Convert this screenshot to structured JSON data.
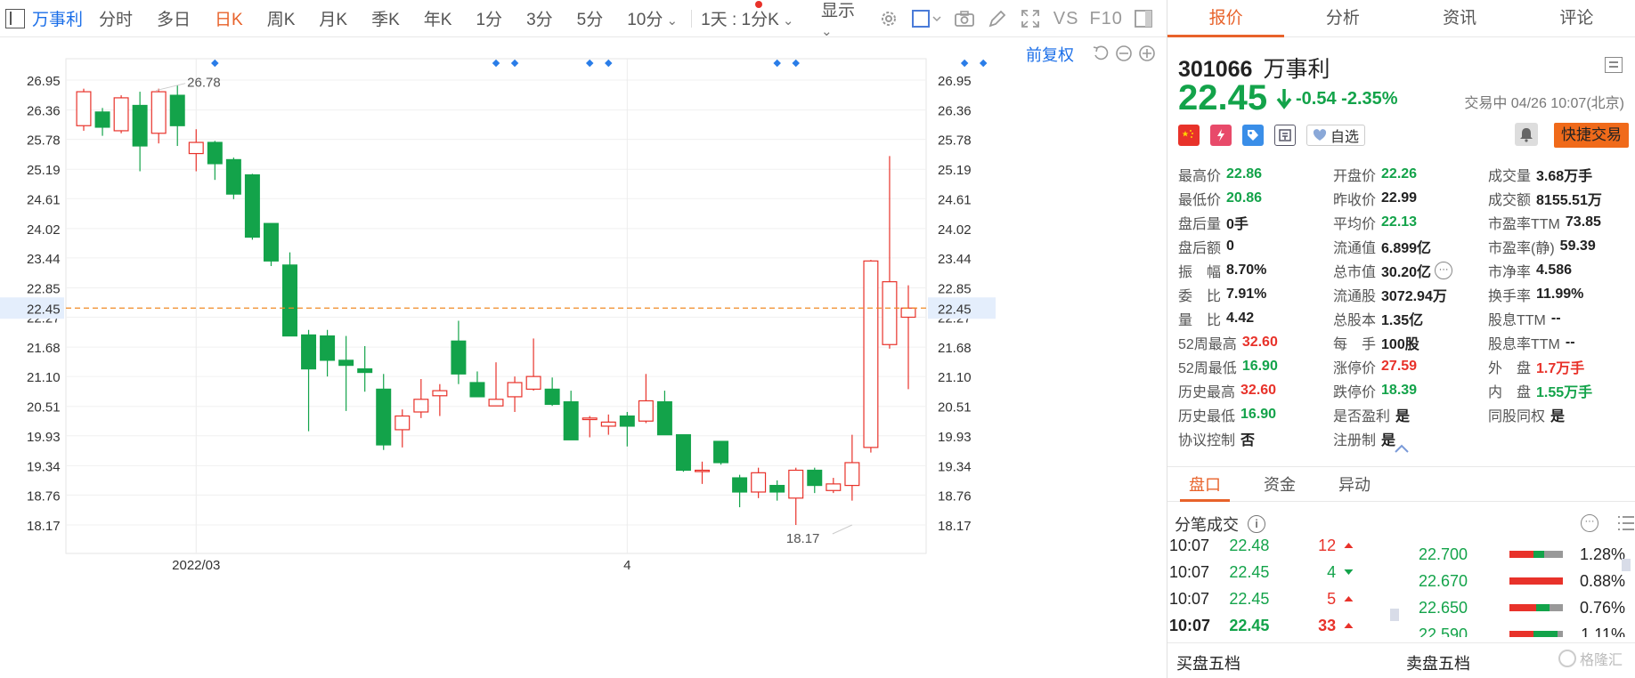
{
  "toolbar": {
    "stock_name": "万事利",
    "periods": [
      "分时",
      "多日",
      "日K",
      "周K",
      "月K",
      "季K",
      "年K",
      "1分",
      "3分",
      "5分",
      "10分"
    ],
    "active_period": "日K",
    "multi_period": "1天 : 1分K",
    "display": "显示",
    "vs": "VS",
    "f10": "F10"
  },
  "chart": {
    "adjust_label": "前复权",
    "current_price_label": "22.45",
    "high_annotation": "26.78",
    "low_annotation": "18.17"
  },
  "chart_data": {
    "type": "candlestick",
    "title": "",
    "x_tick_labels": [
      "2022/03",
      "4"
    ],
    "x_tick_index": [
      6,
      29
    ],
    "y_ticks": [
      "26.95",
      "26.36",
      "25.78",
      "25.19",
      "24.61",
      "24.02",
      "23.44",
      "22.85",
      "22.27",
      "21.68",
      "21.10",
      "20.51",
      "19.93",
      "19.34",
      "18.76",
      "18.17"
    ],
    "ylim": [
      18.17,
      26.95
    ],
    "grid": true,
    "current_price": 22.45,
    "high_annotation": {
      "index": 4,
      "value": 26.78
    },
    "low_annotation": {
      "index": 41,
      "value": 18.17
    },
    "marker_indices": [
      7,
      22,
      23,
      27,
      28,
      37,
      38,
      47,
      48
    ],
    "candles": [
      {
        "o": 26.05,
        "c": 26.72,
        "h": 26.78,
        "l": 25.95
      },
      {
        "o": 26.32,
        "c": 26.02,
        "h": 26.4,
        "l": 25.85
      },
      {
        "o": 25.95,
        "c": 26.6,
        "h": 26.65,
        "l": 25.9
      },
      {
        "o": 26.45,
        "c": 25.65,
        "h": 26.72,
        "l": 25.15
      },
      {
        "o": 25.9,
        "c": 26.72,
        "h": 26.78,
        "l": 25.7
      },
      {
        "o": 26.65,
        "c": 26.05,
        "h": 26.85,
        "l": 25.65
      },
      {
        "o": 25.5,
        "c": 25.72,
        "h": 25.98,
        "l": 25.15
      },
      {
        "o": 25.72,
        "c": 25.3,
        "h": 25.75,
        "l": 24.98
      },
      {
        "o": 25.38,
        "c": 24.7,
        "h": 25.42,
        "l": 24.6
      },
      {
        "o": 25.08,
        "c": 23.85,
        "h": 25.1,
        "l": 23.8
      },
      {
        "o": 24.12,
        "c": 23.38,
        "h": 24.12,
        "l": 23.28
      },
      {
        "o": 23.3,
        "c": 21.9,
        "h": 23.55,
        "l": 21.9
      },
      {
        "o": 21.92,
        "c": 21.25,
        "h": 22.02,
        "l": 20.02
      },
      {
        "o": 21.9,
        "c": 21.42,
        "h": 22.02,
        "l": 21.1
      },
      {
        "o": 21.42,
        "c": 21.32,
        "h": 21.9,
        "l": 20.42
      },
      {
        "o": 21.25,
        "c": 21.18,
        "h": 21.7,
        "l": 20.8
      },
      {
        "o": 20.85,
        "c": 19.75,
        "h": 21.15,
        "l": 19.65
      },
      {
        "o": 20.05,
        "c": 20.32,
        "h": 20.45,
        "l": 19.7
      },
      {
        "o": 20.4,
        "c": 20.65,
        "h": 21.05,
        "l": 20.28
      },
      {
        "o": 20.72,
        "c": 20.82,
        "h": 20.95,
        "l": 20.32
      },
      {
        "o": 21.8,
        "c": 21.15,
        "h": 22.2,
        "l": 20.95
      },
      {
        "o": 20.98,
        "c": 20.7,
        "h": 21.2,
        "l": 20.7
      },
      {
        "o": 20.52,
        "c": 20.65,
        "h": 21.38,
        "l": 20.52
      },
      {
        "o": 20.7,
        "c": 20.98,
        "h": 21.1,
        "l": 20.4
      },
      {
        "o": 20.85,
        "c": 21.1,
        "h": 21.85,
        "l": 20.82
      },
      {
        "o": 20.85,
        "c": 20.55,
        "h": 21.08,
        "l": 20.52
      },
      {
        "o": 20.6,
        "c": 19.85,
        "h": 20.82,
        "l": 19.85
      },
      {
        "o": 20.25,
        "c": 20.28,
        "h": 20.32,
        "l": 19.9
      },
      {
        "o": 20.12,
        "c": 20.2,
        "h": 20.35,
        "l": 19.95
      },
      {
        "o": 20.32,
        "c": 20.12,
        "h": 20.4,
        "l": 19.72
      },
      {
        "o": 20.22,
        "c": 20.62,
        "h": 21.15,
        "l": 20.18
      },
      {
        "o": 20.6,
        "c": 19.95,
        "h": 20.82,
        "l": 19.95
      },
      {
        "o": 19.95,
        "c": 19.25,
        "h": 19.95,
        "l": 19.22
      },
      {
        "o": 19.25,
        "c": 19.25,
        "h": 19.42,
        "l": 18.98
      },
      {
        "o": 19.82,
        "c": 19.4,
        "h": 19.82,
        "l": 19.36
      },
      {
        "o": 19.1,
        "c": 18.82,
        "h": 19.16,
        "l": 18.52
      },
      {
        "o": 18.82,
        "c": 19.2,
        "h": 19.3,
        "l": 18.7
      },
      {
        "o": 18.95,
        "c": 18.82,
        "h": 19.05,
        "l": 18.65
      },
      {
        "o": 18.7,
        "c": 19.25,
        "h": 19.3,
        "l": 18.17
      },
      {
        "o": 19.25,
        "c": 18.95,
        "h": 19.3,
        "l": 18.8
      },
      {
        "o": 18.85,
        "c": 18.98,
        "h": 19.1,
        "l": 18.8
      },
      {
        "o": 18.95,
        "c": 19.4,
        "h": 19.95,
        "l": 18.65
      },
      {
        "o": 19.7,
        "c": 23.38,
        "h": 23.4,
        "l": 19.6
      },
      {
        "o": 21.73,
        "c": 22.97,
        "h": 25.45,
        "l": 21.65
      },
      {
        "o": 22.27,
        "c": 22.45,
        "h": 22.9,
        "l": 20.85
      }
    ]
  },
  "quote": {
    "tabs": [
      "报价",
      "分析",
      "资讯",
      "评论"
    ],
    "active_tab": "报价",
    "code": "301066",
    "name": "万事利",
    "price": "22.45",
    "change": "-0.54",
    "change_pct": "-2.35%",
    "status_time": "交易中 04/26 10:07(北京)",
    "watch_label": "自选",
    "quick_trade": "快捷交易",
    "fields": [
      [
        {
          "k": "最高价",
          "v": "22.86",
          "c": "dn"
        },
        {
          "k": "开盘价",
          "v": "22.26",
          "c": "dn"
        },
        {
          "k": "成交量",
          "v": "3.68万手",
          "c": ""
        }
      ],
      [
        {
          "k": "最低价",
          "v": "20.86",
          "c": "dn"
        },
        {
          "k": "昨收价",
          "v": "22.99",
          "c": ""
        },
        {
          "k": "成交额",
          "v": "8155.51万",
          "c": ""
        }
      ],
      [
        {
          "k": "盘后量",
          "v": "0手",
          "c": ""
        },
        {
          "k": "平均价",
          "v": "22.13",
          "c": "dn"
        },
        {
          "k": "市盈率TTM",
          "v": "73.85",
          "c": ""
        }
      ],
      [
        {
          "k": "盘后额",
          "v": "0",
          "c": ""
        },
        {
          "k": "流通值",
          "v": "6.899亿",
          "c": ""
        },
        {
          "k": "市盈率(静)",
          "v": "59.39",
          "c": ""
        }
      ],
      [
        {
          "k": "振　幅",
          "v": "8.70%",
          "c": ""
        },
        {
          "k": "总市值",
          "v": "30.20亿",
          "c": ""
        },
        {
          "k": "市净率",
          "v": "4.586",
          "c": ""
        }
      ],
      [
        {
          "k": "委　比",
          "v": "7.91%",
          "c": ""
        },
        {
          "k": "流通股",
          "v": "3072.94万",
          "c": ""
        },
        {
          "k": "换手率",
          "v": "11.99%",
          "c": ""
        }
      ],
      [
        {
          "k": "量　比",
          "v": "4.42",
          "c": ""
        },
        {
          "k": "总股本",
          "v": "1.35亿",
          "c": ""
        },
        {
          "k": "股息TTM",
          "v": "--",
          "c": ""
        }
      ],
      [
        {
          "k": "52周最高",
          "v": "32.60",
          "c": "up"
        },
        {
          "k": "每　手",
          "v": "100股",
          "c": ""
        },
        {
          "k": "股息率TTM",
          "v": "--",
          "c": ""
        }
      ],
      [
        {
          "k": "52周最低",
          "v": "16.90",
          "c": "dn"
        },
        {
          "k": "涨停价",
          "v": "27.59",
          "c": "up"
        },
        {
          "k": "外　盘",
          "v": "1.7万手",
          "c": "up"
        }
      ],
      [
        {
          "k": "历史最高",
          "v": "32.60",
          "c": "up"
        },
        {
          "k": "跌停价",
          "v": "18.39",
          "c": "dn"
        },
        {
          "k": "内　盘",
          "v": "1.55万手",
          "c": "dn"
        }
      ],
      [
        {
          "k": "历史最低",
          "v": "16.90",
          "c": "dn"
        },
        {
          "k": "是否盈利",
          "v": "是",
          "c": ""
        },
        {
          "k": "同股同权",
          "v": "是",
          "c": ""
        }
      ],
      [
        {
          "k": "协议控制",
          "v": "否",
          "c": ""
        },
        {
          "k": "注册制",
          "v": "是",
          "c": ""
        },
        {
          "k": "",
          "v": "",
          "c": ""
        }
      ]
    ]
  },
  "ticks": {
    "subtabs": [
      "盘口",
      "资金",
      "异动"
    ],
    "active_subtab": "盘口",
    "title": "分笔成交",
    "rows": [
      {
        "t": "10:07",
        "p": "22.48",
        "v": "12",
        "dir": "up",
        "bold": false
      },
      {
        "t": "10:07",
        "p": "22.45",
        "v": "4",
        "dir": "dn",
        "bold": false
      },
      {
        "t": "10:07",
        "p": "22.45",
        "v": "5",
        "dir": "up",
        "bold": false
      },
      {
        "t": "10:07",
        "p": "22.45",
        "v": "33",
        "dir": "up",
        "bold": true
      }
    ],
    "depth": [
      {
        "p": "22.700",
        "pct": "1.28%",
        "bar": [
          0.45,
          0.2,
          0.35
        ]
      },
      {
        "p": "22.670",
        "pct": "0.88%",
        "bar": [
          1.0,
          0,
          0
        ]
      },
      {
        "p": "22.650",
        "pct": "0.76%",
        "bar": [
          0.5,
          0.25,
          0.25
        ]
      },
      {
        "p": "22.590",
        "pct": "1.11%",
        "bar": [
          0.45,
          0.45,
          0.1
        ]
      }
    ],
    "buy5": "买盘五档",
    "sell5": "卖盘五档",
    "watermark": "格隆汇"
  }
}
